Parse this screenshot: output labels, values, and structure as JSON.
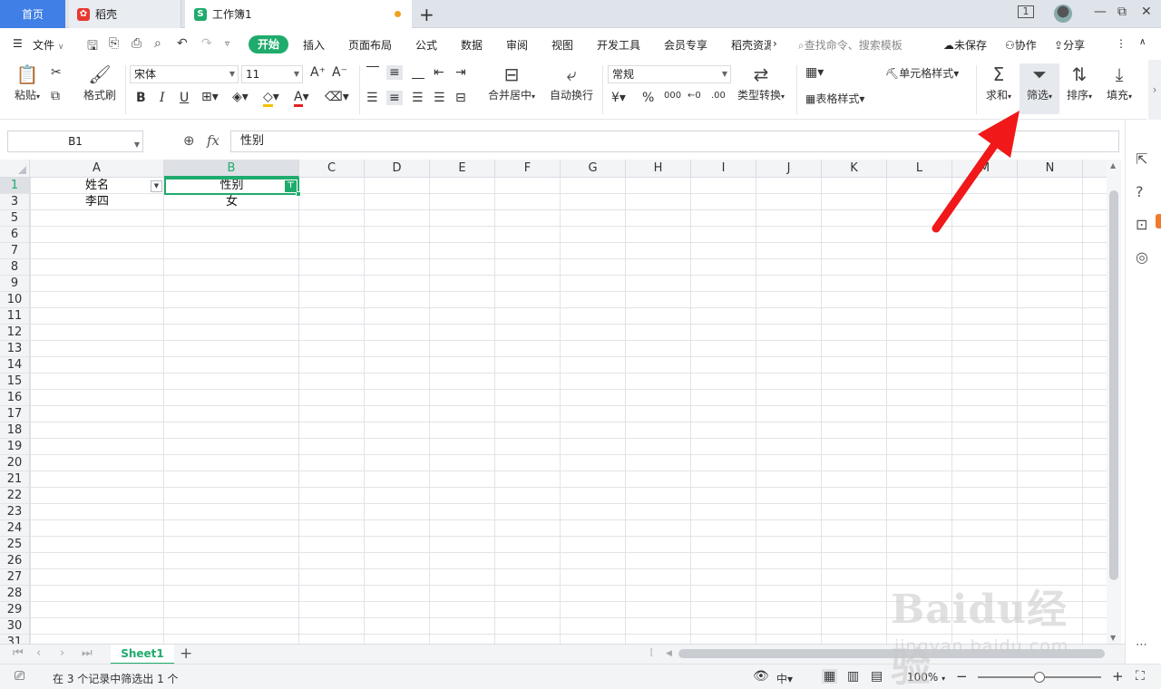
{
  "tabs": {
    "home": "首页",
    "shell": "稻壳",
    "doc": "工作簿1"
  },
  "window": {
    "badge": "1",
    "minimize": "—",
    "restore": "⧉",
    "close": "✕"
  },
  "menu": {
    "file": "文件",
    "start": "开始",
    "items": [
      "插入",
      "页面布局",
      "公式",
      "数据",
      "审阅",
      "视图",
      "开发工具",
      "会员专享",
      "稻壳资源"
    ],
    "search_placeholder": "查找命令、搜索模板",
    "unsaved": "未保存",
    "collab": "协作",
    "share": "分享"
  },
  "ribbon": {
    "paste": "粘贴",
    "format_painter": "格式刷",
    "font_name": "宋体",
    "font_size": "11",
    "merge_center": "合并居中",
    "wrap_text": "自动换行",
    "number_format": "常规",
    "type_convert": "类型转换",
    "cell_style": "单元格样式",
    "table_style": "表格样式",
    "sum": "求和",
    "filter": "筛选",
    "sort": "排序",
    "fill": "填充"
  },
  "formula_bar": {
    "name_box": "B1",
    "fx": "fx",
    "value": "性别"
  },
  "columns": [
    "A",
    "B",
    "C",
    "D",
    "E",
    "F",
    "G",
    "H",
    "I",
    "J",
    "K",
    "L",
    "M",
    "N"
  ],
  "rows": [
    "1",
    "3",
    "5",
    "6",
    "7",
    "8",
    "9",
    "10",
    "11",
    "12",
    "13",
    "14",
    "15",
    "16",
    "17",
    "18",
    "19",
    "20",
    "21",
    "22",
    "23",
    "24",
    "25",
    "26",
    "27",
    "28",
    "29",
    "30",
    "31"
  ],
  "cells": {
    "a1": "姓名",
    "b1": "性别",
    "a3": "李四",
    "b3": "女"
  },
  "sheet": {
    "name": "Sheet1"
  },
  "status": {
    "filter_info": "在 3 个记录中筛选出 1 个",
    "zoom": "100%",
    "input_mode": "中"
  },
  "watermark": {
    "brand": "Baidu经验",
    "url": "jingyan.baidu.com"
  }
}
